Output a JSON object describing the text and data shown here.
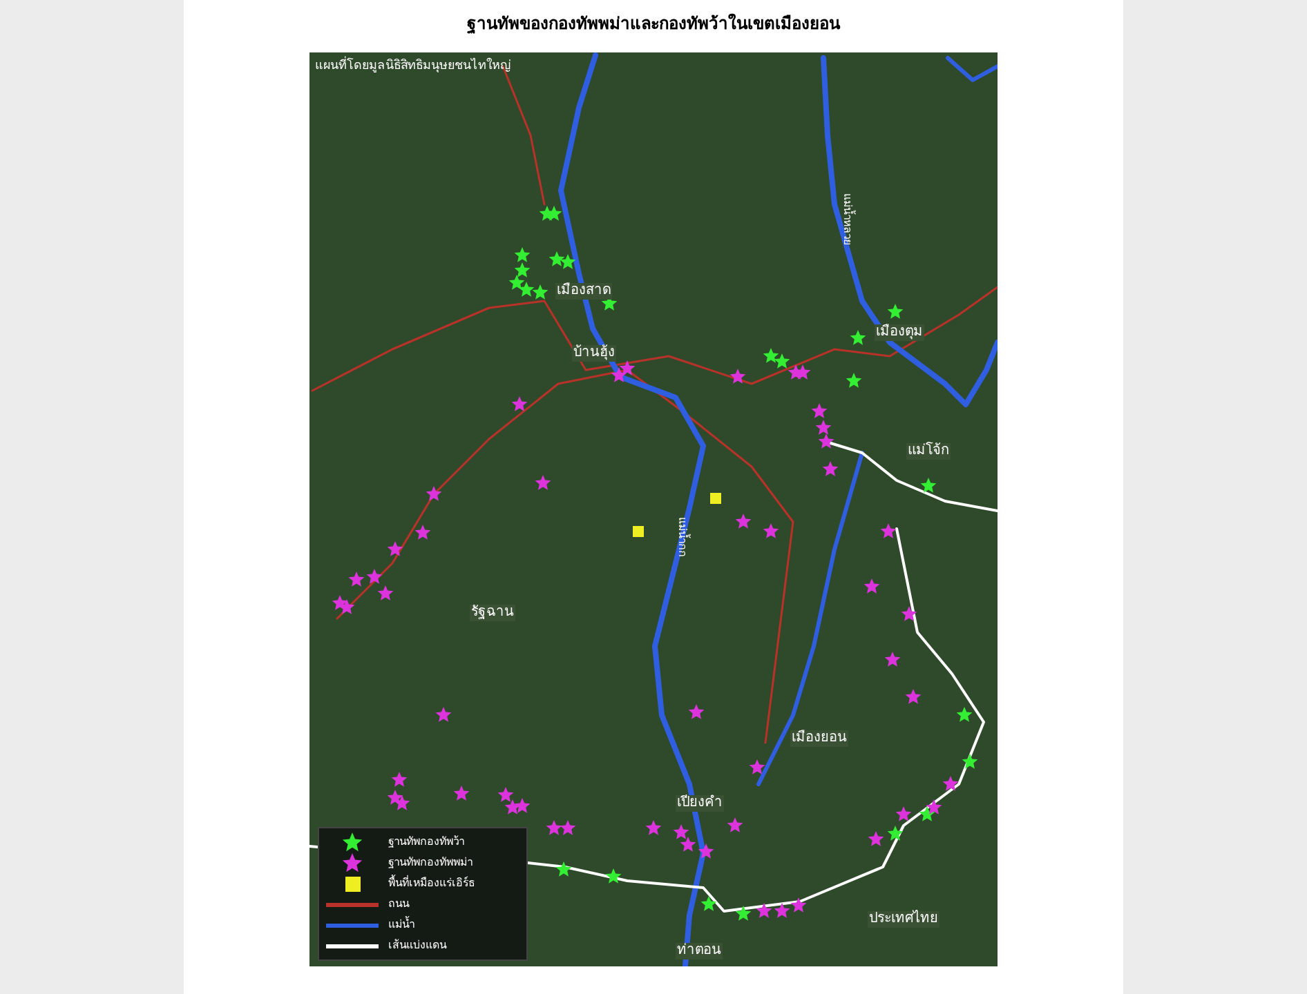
{
  "title": "ฐานทัพของกองทัพพม่าและกองทัพว้าในเขตเมืองยอน",
  "map": {
    "credit": "แผนที่โดยมูลนิธิสิทธิมนุษยชนไทใหญ่",
    "place_labels": [
      {
        "text": "เมืองสาด"
      },
      {
        "text": "บ้านฮุ้ง"
      },
      {
        "text": "เมืองตุม"
      },
      {
        "text": "แม่โจ้ก"
      },
      {
        "text": "รัฐฉาน"
      },
      {
        "text": "เมืองยอน"
      },
      {
        "text": "เปียงคำ"
      },
      {
        "text": "ท่าตอน"
      },
      {
        "text": "ประเทศไทย"
      }
    ],
    "river_labels": [
      {
        "text": "แม่น้ำกก"
      },
      {
        "text": "แม่น้ำหลวย"
      }
    ],
    "legend": [
      {
        "kind": "star",
        "color": "#33ee33",
        "label": "ฐานทัพกองทัพว้า"
      },
      {
        "kind": "star",
        "color": "#dd33dd",
        "label": "ฐานทัพกองทัพพม่า"
      },
      {
        "kind": "square",
        "color": "#eeee22",
        "label": "พื้นที่เหมืองแร่เอิร์ธ"
      },
      {
        "kind": "line",
        "color": "#b8322a",
        "label": "ถนน"
      },
      {
        "kind": "line",
        "color": "#2f5fe0",
        "label": "แม่น้ำ"
      },
      {
        "kind": "line",
        "color": "#ffffff",
        "label": "เส้นแบ่งแดน"
      }
    ]
  }
}
